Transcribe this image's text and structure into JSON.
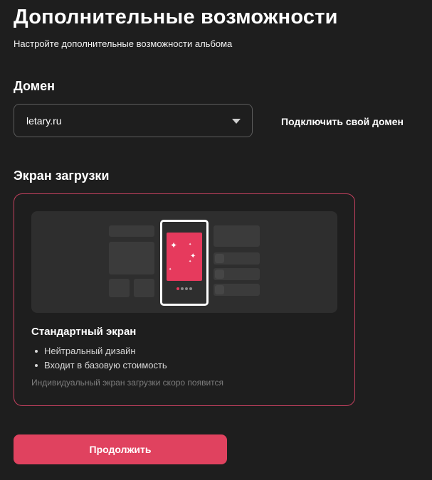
{
  "header": {
    "title": "Дополнительные возможности",
    "subtitle": "Настройте дополнительные возможности альбома"
  },
  "domain": {
    "section_title": "Домен",
    "selected_value": "letary.ru",
    "connect_link": "Подключить свой домен"
  },
  "loading_screen": {
    "section_title": "Экран загрузки",
    "card": {
      "title": "Стандартный экран",
      "features": [
        "Нейтральный дизайн",
        "Входит в базовую стоимость"
      ],
      "note": "Индивидуальный экран загрузки скоро появится",
      "selected": true,
      "accent_color": "#e63a5d",
      "border_color": "#c2405e"
    }
  },
  "actions": {
    "continue_label": "Продолжить",
    "continue_color": "#e0425f"
  },
  "icons": {
    "dropdown": "chevron-down-icon",
    "sparkle": "sparkle-icon"
  }
}
